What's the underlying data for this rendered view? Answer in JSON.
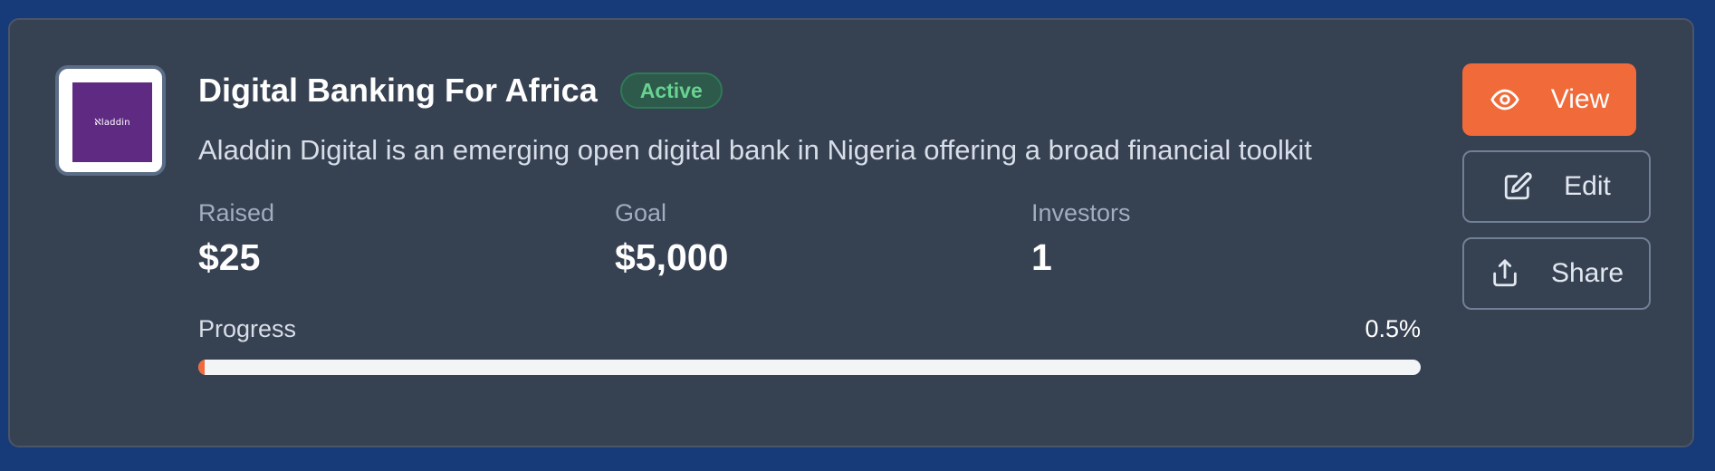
{
  "campaign": {
    "logo_text": "ℵladdin",
    "title": "Digital Banking For Africa",
    "status": "Active",
    "description": "Aladdin Digital is an emerging open digital bank in Nigeria offering a broad financial toolkit"
  },
  "stats": {
    "raised_label": "Raised",
    "raised_value": "$25",
    "goal_label": "Goal",
    "goal_value": "$5,000",
    "investors_label": "Investors",
    "investors_value": "1"
  },
  "progress": {
    "label": "Progress",
    "value_text": "0.5%",
    "fraction": 0.005
  },
  "actions": {
    "view_label": "View",
    "edit_label": "Edit",
    "share_label": "Share"
  },
  "colors": {
    "page_background": "#173a78",
    "card_background": "#364152",
    "accent": "#f06a3a",
    "status_green": "#68d391",
    "logo_purple": "#5e2a82"
  },
  "icons": {
    "view": "eye-icon",
    "edit": "edit-icon",
    "share": "share-icon"
  }
}
